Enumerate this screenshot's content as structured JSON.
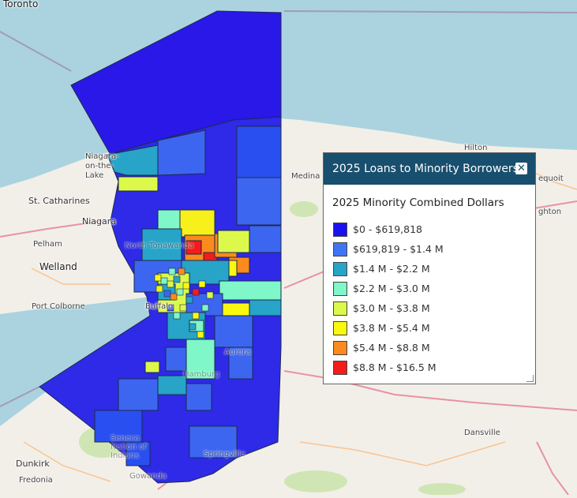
{
  "legend": {
    "title": "2025 Loans to Minority Borrowers",
    "subtitle": "2025 Minority Combined Dollars",
    "close_icon": "close-icon",
    "items": [
      {
        "label": "$0 - $619,818",
        "color": "#1b10ee"
      },
      {
        "label": "$619,819 - $1.4 M",
        "color": "#3f74f4"
      },
      {
        "label": "$1.4 M - $2.2 M",
        "color": "#27a4c8"
      },
      {
        "label": "$2.2 M - $3.0 M",
        "color": "#7ff7c8"
      },
      {
        "label": "$3.0 M - $3.8 M",
        "color": "#dcf94b"
      },
      {
        "label": "$3.8 M - $5.4 M",
        "color": "#fbf80f"
      },
      {
        "label": "$5.4 M - $8.8 M",
        "color": "#fb8b1d"
      },
      {
        "label": "$8.8 M - $16.5 M",
        "color": "#f41b1b"
      }
    ]
  },
  "places": {
    "toronto": "Toronto",
    "st_catharines": "St. Catharines",
    "niagara": "Niagara",
    "niagara_otl": "Niagara-on-the-Lake",
    "pelham": "Pelham",
    "welland": "Welland",
    "port_colborne": "Port Colborne",
    "medina": "Medina",
    "hilton": "Hilton",
    "dunkirk": "Dunkirk",
    "fredonia": "Fredonia",
    "dansville": "Dansville",
    "equoit": "equoit",
    "ighton": "ghton",
    "north_tonawanda": "North Tonawanda",
    "buffalo": "Buffalo",
    "aurora": "Aurora",
    "springville": "Springville",
    "seneca": "Seneca Nation of Indians",
    "gowanda": "Gowanda",
    "hamburg": "Hamburg"
  }
}
